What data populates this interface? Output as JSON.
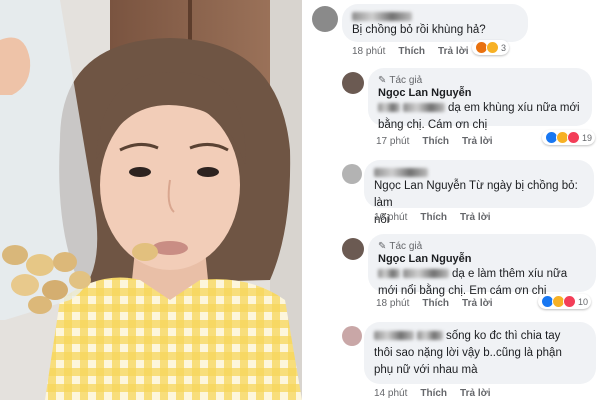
{
  "comments": [
    {
      "text": "Bị chồng bỏ rồi khùng hả?",
      "time": "18 phút",
      "like": "Thích",
      "reply": "Trả lời",
      "reaction_count": "3",
      "reaction_icons": [
        "like-icon",
        "haha-icon"
      ]
    },
    {
      "badge": "Tác giả",
      "author": "Ngọc Lan Nguyễn",
      "line1": "dạ em khùng xíu nữa mới",
      "line2": "bằng chị. Cám ơn chị",
      "time": "17 phút",
      "like": "Thích",
      "reply": "Trả lời",
      "reaction_count": "19",
      "reaction_icons": [
        "like-icon",
        "haha-icon",
        "love-icon"
      ]
    },
    {
      "line1": "Ngọc Lan Nguyễn Từ ngày bị chồng bỏ: làm",
      "line2": "nổi",
      "time": "16 phút",
      "like": "Thích",
      "reply": "Trả lời"
    },
    {
      "badge": "Tác giả",
      "author": "Ngọc Lan Nguyễn",
      "line1": "dạ e làm thêm xíu nữa",
      "line2": "mới nổi bằng chị. Em cám ơn chị",
      "time": "18 phút",
      "like": "Thích",
      "reply": "Trả lời",
      "reaction_count": "10",
      "reaction_icons": [
        "like-icon",
        "haha-icon",
        "love-icon"
      ]
    },
    {
      "line1": "sống ko đc thì chia tay",
      "line2": "thôi sao nặng lời vậy b..cũng là phận",
      "line3": "phụ nữ với nhau mà",
      "time": "14 phút",
      "like": "Thích",
      "reply": "Trả lời"
    }
  ],
  "colors": {
    "bubble": "#f0f2f5",
    "meta_text": "#65676b",
    "like": "#1877f2",
    "love": "#f33e58",
    "haha": "#f7b125"
  }
}
